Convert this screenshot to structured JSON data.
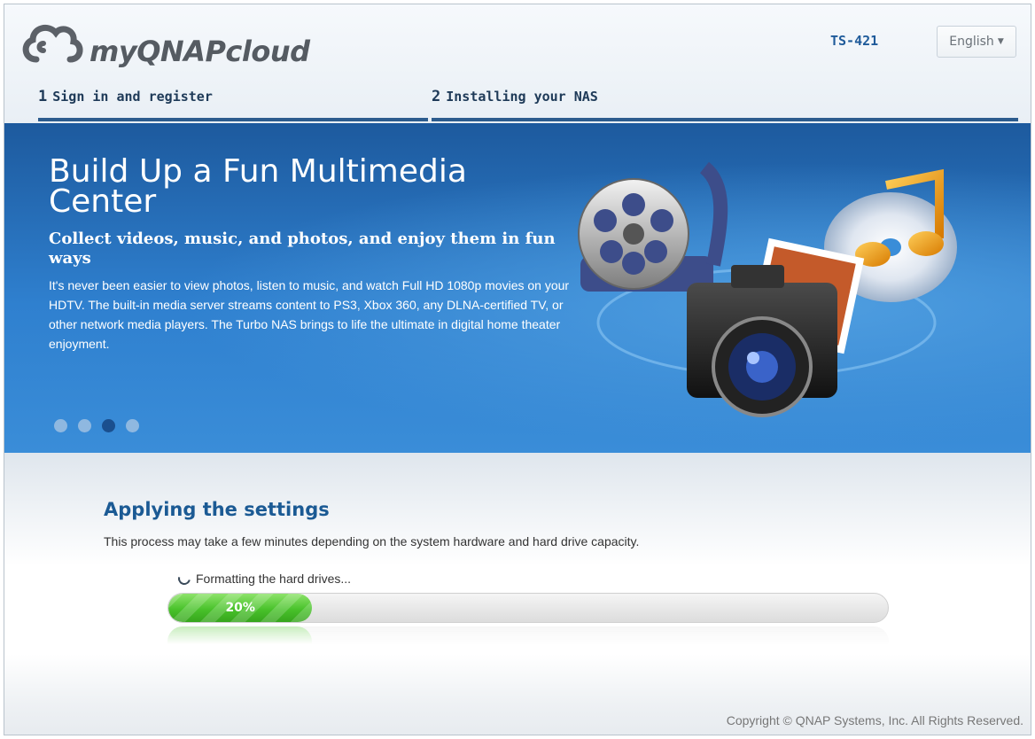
{
  "header": {
    "logo_text": "myQNAPcloud",
    "model": "TS-421",
    "language": "English"
  },
  "steps": [
    {
      "number": "1",
      "label": "Sign in and register"
    },
    {
      "number": "2",
      "label": "Installing your NAS"
    }
  ],
  "banner": {
    "title": "Build Up a Fun Multimedia Center",
    "subtitle": "Collect videos, music, and photos, and enjoy them in fun ways",
    "body": "It's never been easier to view photos, listen to music, and watch Full HD 1080p movies on your HDTV. The built-in media server streams content to PS3, Xbox 360, any DLNA-certified TV, or other network media players. The Turbo NAS brings to life the ultimate in digital home theater enjoyment.",
    "slide_count": 4,
    "active_slide": 3
  },
  "main": {
    "title": "Applying the settings",
    "description": "This process may take a few minutes depending on the system hardware and hard drive capacity.",
    "status": "Formatting the hard drives...",
    "progress_label": "20%",
    "progress_percent": 20
  },
  "footer": {
    "copyright": "Copyright © QNAP Systems, Inc. All Rights Reserved."
  },
  "colors": {
    "accent": "#1b5a94",
    "banner": "#2f80cf",
    "progress": "#49c22b"
  }
}
